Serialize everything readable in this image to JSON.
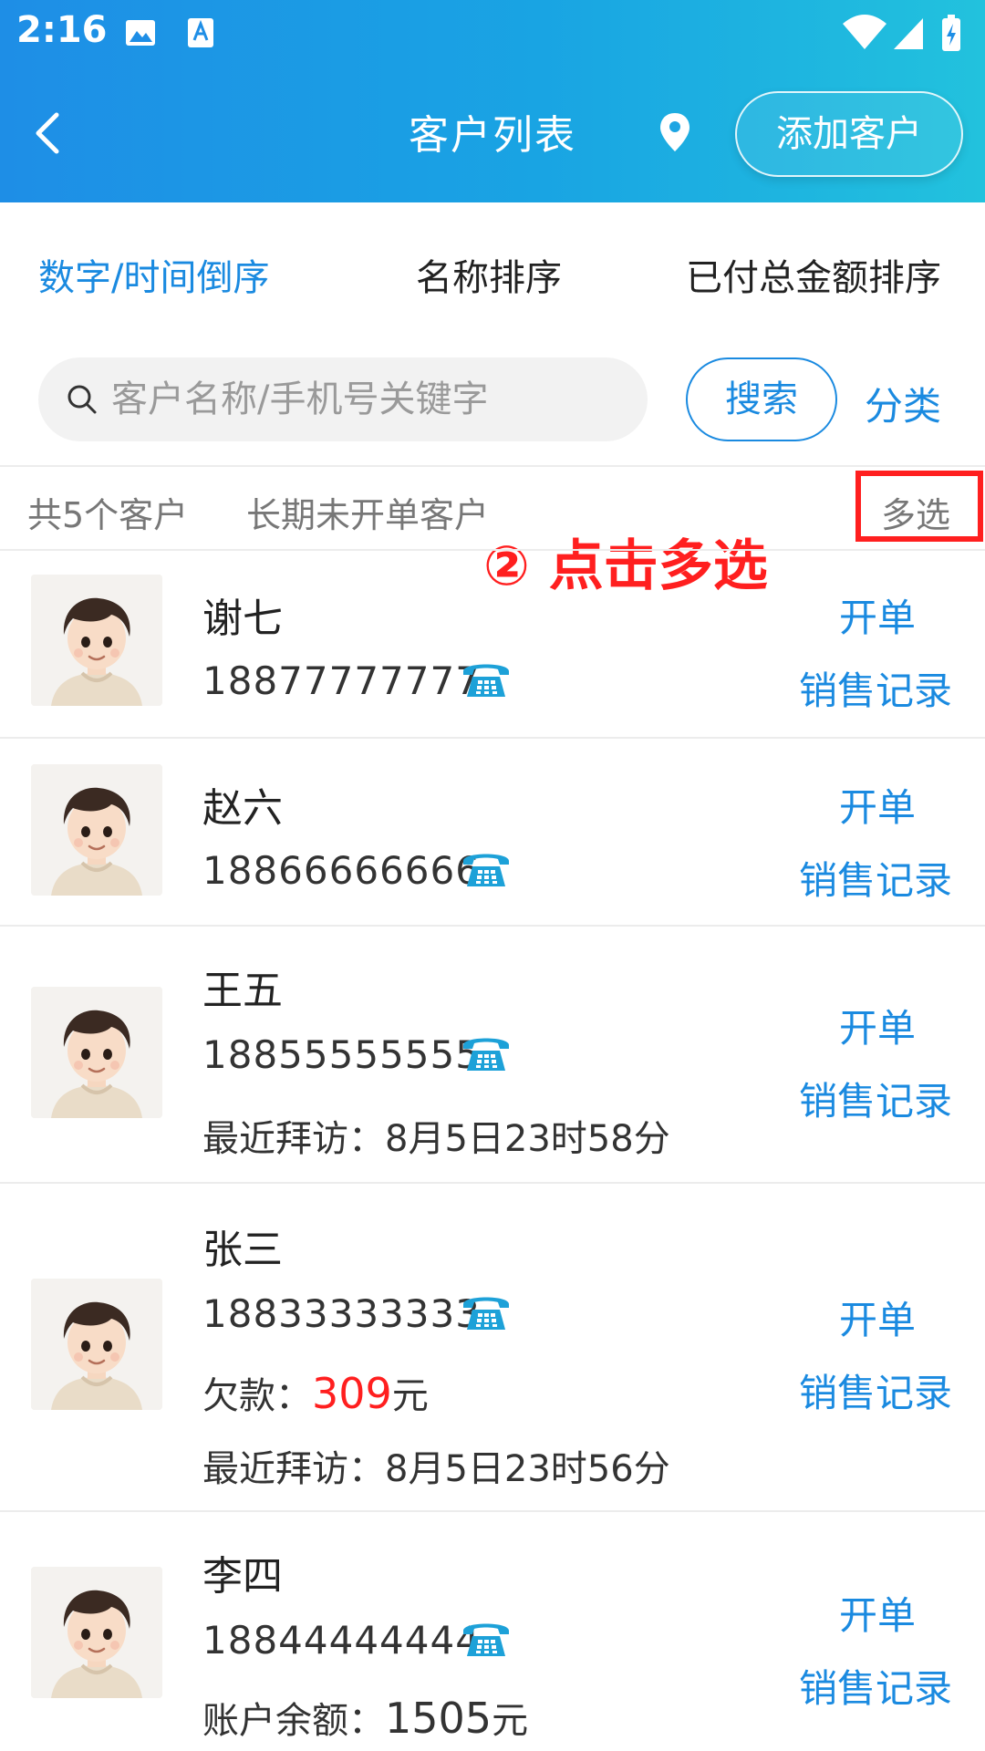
{
  "status_bar": {
    "time": "2:16"
  },
  "header": {
    "title": "客户列表",
    "add_label": "添加客户"
  },
  "sort_tabs": [
    {
      "label": "数字/时间倒序",
      "active": true
    },
    {
      "label": "名称排序",
      "active": false
    },
    {
      "label": "已付总金额排序",
      "active": false
    }
  ],
  "search": {
    "placeholder": "客户名称/手机号关键字",
    "value": "",
    "button_label": "搜索",
    "category_label": "分类"
  },
  "filter": {
    "count_text": "共5个客户",
    "inactive_label": "长期未开单客户",
    "multi_select_label": "多选"
  },
  "annotation": "② 点击多选",
  "customers": [
    {
      "name": "谢七",
      "phone": "18877777777",
      "order_label": "开单",
      "sales_label": "销售记录"
    },
    {
      "name": "赵六",
      "phone": "18866666666",
      "order_label": "开单",
      "sales_label": "销售记录"
    },
    {
      "name": "王五",
      "phone": "18855555555",
      "visit_label": "最近拜访：",
      "visit_value": "8月5日23时58分",
      "order_label": "开单",
      "sales_label": "销售记录"
    },
    {
      "name": "张三",
      "phone": "18833333333",
      "debt_label": "欠款：",
      "debt_value": "309",
      "debt_unit": "元",
      "visit_label": "最近拜访：",
      "visit_value": "8月5日23时56分",
      "order_label": "开单",
      "sales_label": "销售记录"
    },
    {
      "name": "李四",
      "phone": "18844444444",
      "balance_label": "账户余额：",
      "balance_value": "1505",
      "balance_unit": "元",
      "order_label": "开单",
      "sales_label": "销售记录"
    }
  ],
  "colors": {
    "accent": "#1a8ae0",
    "header_start": "#1e8ee6",
    "header_end": "#22c2dd",
    "alert": "#ff1f1f",
    "phone_icon": "#1da1d8"
  },
  "icons": [
    "image-icon",
    "accessibility-icon",
    "wifi-icon",
    "signal-icon",
    "battery-icon",
    "back-arrow-icon",
    "location-pin-icon",
    "search-icon",
    "telephone-icon"
  ]
}
